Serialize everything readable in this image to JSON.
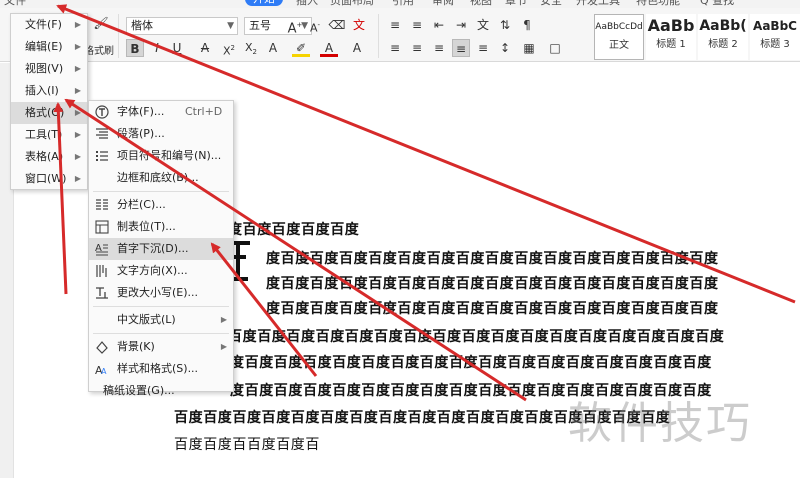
{
  "tabs": [
    {
      "label": "文件"
    },
    {
      "label": "开始",
      "active": true
    },
    {
      "label": "插入"
    },
    {
      "label": "页面布局"
    },
    {
      "label": "引用"
    },
    {
      "label": "审阅"
    },
    {
      "label": "视图"
    },
    {
      "label": "章节"
    },
    {
      "label": "安全"
    },
    {
      "label": "开发工具"
    },
    {
      "label": "特色功能"
    },
    {
      "label": "Q 查找"
    }
  ],
  "ribbon": {
    "format_painter": "格式刷",
    "font_name": "楷体",
    "font_size": "五号",
    "styles": [
      {
        "sample": "AaBbCcDd",
        "name": "正文"
      },
      {
        "sample": "AaBb",
        "name": "标题 1"
      },
      {
        "sample": "AaBb(",
        "name": "标题 2"
      },
      {
        "sample": "AaBbC",
        "name": "标题 3"
      }
    ]
  },
  "main_menu": {
    "items": [
      {
        "label": "文件(F)"
      },
      {
        "label": "编辑(E)"
      },
      {
        "label": "视图(V)"
      },
      {
        "label": "插入(I)"
      },
      {
        "label": "格式(O)"
      },
      {
        "label": "工具(T)"
      },
      {
        "label": "表格(A)"
      },
      {
        "label": "窗口(W)"
      }
    ]
  },
  "format_menu": {
    "items": [
      {
        "label": "字体(F)...",
        "shortcut": "Ctrl+D",
        "icon": "font-icon"
      },
      {
        "label": "段落(P)...",
        "icon": "paragraph-icon"
      },
      {
        "label": "项目符号和编号(N)...",
        "icon": "bullet-list-icon"
      },
      {
        "label": "边框和底纹(B)...",
        "icon": ""
      },
      {
        "label": "分栏(C)...",
        "icon": "columns-icon"
      },
      {
        "label": "制表位(T)...",
        "icon": "tab-stop-icon"
      },
      {
        "label": "首字下沉(D)...",
        "icon": "drop-cap-icon"
      },
      {
        "label": "文字方向(X)...",
        "icon": "text-direction-icon"
      },
      {
        "label": "更改大小写(E)...",
        "icon": "change-case-icon"
      },
      {
        "label": "中文版式(L)",
        "icon": ""
      },
      {
        "label": "背景(K)",
        "icon": "background-icon"
      },
      {
        "label": "样式和格式(S)...",
        "icon": "styles-icon"
      },
      {
        "label": "稿纸设置(G)...",
        "icon": ""
      }
    ]
  },
  "document": {
    "lines": [
      "度百度百度百度百度",
      "度百度百度百度百度百度百度百度百度百度百度百度百度百度百度百度",
      "度百度百度百度百度百度百度百度百度百度百度百度百度百度百度百度",
      "度百度百度百度百度百度百度百度百度百度百度百度百度百度百度百度",
      "百度百度百度百度百度百度百度百度百度百度百度百度百度百度百度百度百度",
      "度百度百度百度百度百度百度百度百度百度百度百度百度百度百度百度百度",
      "度百度百度百度百度百度百度百度百度百度百度百度百度百度百度百度百度",
      "百度百度百度百度百度百度百度百度百度百度百度百度百度百度百度百度百度",
      "百度百度百百度百度百"
    ]
  },
  "watermark": "软件技巧",
  "colors": {
    "accent": "#2f7cf6",
    "annotation_arrow": "#d62a2a",
    "font_color_red": "#d40000",
    "highlight_yellow": "#f6d300"
  }
}
